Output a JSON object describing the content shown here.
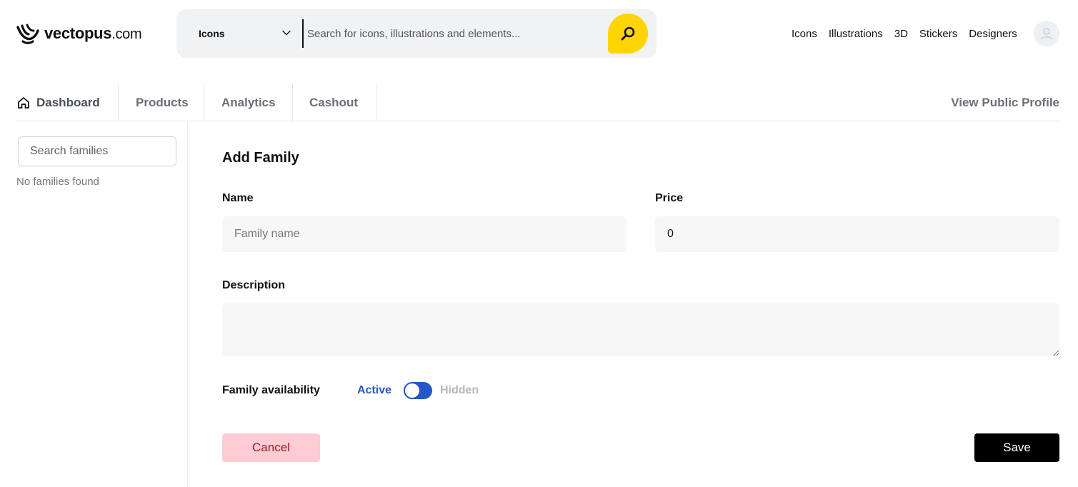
{
  "brand": {
    "name_main": "vectopus",
    "name_domain": ".com",
    "logo_icon": "octopus-logo-icon"
  },
  "search": {
    "type_selected": "Icons",
    "placeholder": "Search for icons, illustrations and elements...",
    "accent_color": "#ffd400"
  },
  "top_nav": {
    "items": [
      "Icons",
      "Illustrations",
      "3D",
      "Stickers",
      "Designers"
    ]
  },
  "tabs": {
    "items": [
      {
        "label": "Dashboard",
        "icon": "home-icon"
      },
      {
        "label": "Products"
      },
      {
        "label": "Analytics"
      },
      {
        "label": "Cashout"
      }
    ],
    "public_profile": "View Public Profile"
  },
  "sidebar": {
    "search_placeholder": "Search families",
    "empty_text": "No families found"
  },
  "form": {
    "title": "Add Family",
    "name_label": "Name",
    "name_placeholder": "Family name",
    "price_label": "Price",
    "price_value": "0",
    "description_label": "Description",
    "description_value": "",
    "availability_label": "Family availability",
    "availability_active": "Active",
    "availability_hidden": "Hidden",
    "availability_state": "Active",
    "cancel_label": "Cancel",
    "save_label": "Save"
  },
  "colors": {
    "toggle_on": "#2557c9",
    "active_text": "#2657c5",
    "cancel_bg": "#ffccd4",
    "save_bg": "#000000"
  }
}
